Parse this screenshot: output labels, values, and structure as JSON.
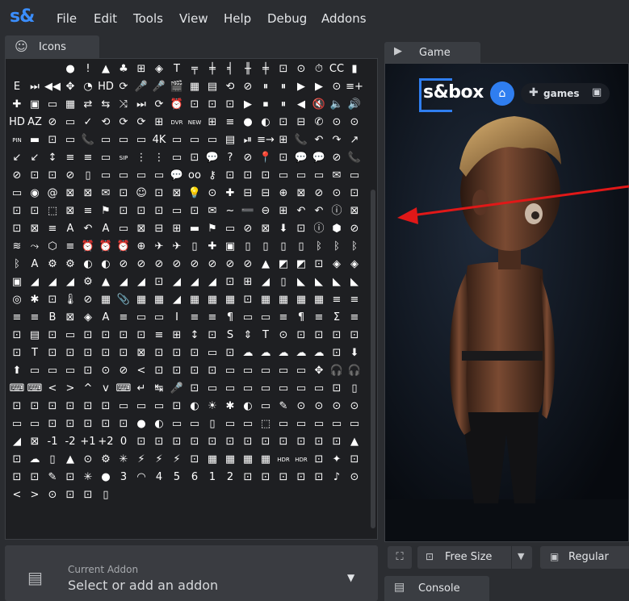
{
  "app": {
    "logo": "s&"
  },
  "menu": [
    "File",
    "Edit",
    "Tools",
    "View",
    "Help",
    "Debug",
    "Addons"
  ],
  "icons_panel": {
    "tab_label": "Icons",
    "tab_icon": "smiley-icon",
    "glyphs": [
      "",
      "",
      "",
      "●",
      "!",
      "▲",
      "♣",
      "⊞",
      "◈",
      "T",
      "╤",
      "╪",
      "╡",
      "╫",
      "╪",
      "⊡",
      "⊙",
      "⏱",
      "CC",
      "▮",
      "E",
      "⏭",
      "◀◀",
      "✥",
      "◔",
      "HD",
      "⟳",
      "🎤",
      "🎤",
      "🎬",
      "▦",
      "▤",
      "⟲",
      "⊘",
      "⏸",
      "⏸",
      "▶",
      "▶",
      "⊙",
      "≡+",
      "✚",
      "▣",
      "▭",
      "▦",
      "⇄",
      "⇆",
      "⤨",
      "⏭",
      "⟳",
      "⏰",
      "⊡",
      "⊡",
      "⊡",
      "▶",
      "⏹",
      "⏸",
      "◀",
      "🔇",
      "🔈",
      "🔊",
      "HD",
      "AZ",
      "⊘",
      "▭",
      "✓",
      "⟲",
      "⟳",
      "⟳",
      "⊞",
      "DVR",
      "NEW",
      "⊞",
      "≡",
      "●",
      "◐",
      "⊡",
      "⊟",
      "✆",
      "⊙",
      "⊙",
      "PIN",
      "▬",
      "⊡",
      "▭",
      "📞",
      "▭",
      "▭",
      "▭",
      "4K",
      "▭",
      "▭",
      "▭",
      "▤",
      "⏯",
      "≡→",
      "⊞",
      "📞",
      "↶",
      "↷",
      "↗",
      "↙",
      "↙",
      "↕",
      "≡",
      "≡",
      "▭",
      "SIP",
      "⋮",
      "⋮",
      "▭",
      "⊡",
      "💬",
      "?",
      "⊘",
      "📍",
      "⊡",
      "💬",
      "💬",
      "⊘",
      "📞",
      "⊘",
      "⊡",
      "⊡",
      "⊘",
      "▯",
      "▭",
      "▭",
      "▭",
      "▭",
      "💬",
      "oo",
      "⚷",
      "⊡",
      "⊡",
      "⊡",
      "▭",
      "▭",
      "▭",
      "✉",
      "▭",
      "▭",
      "◉",
      "@",
      "⊠",
      "⊠",
      "✉",
      "⊡",
      "☺",
      "⊡",
      "⊠",
      "💡",
      "⊙",
      "✚",
      "⊟",
      "⊟",
      "⊕",
      "⊠",
      "⊘",
      "⊙",
      "⊡",
      "⊡",
      "⊡",
      "⬚",
      "⊠",
      "≡",
      "⚑",
      "⊡",
      "⊡",
      "⊡",
      "▭",
      "⊡",
      "✉",
      "∼",
      "➖",
      "⊖",
      "⊞",
      "↶",
      "↶",
      "ⓘ",
      "⊠",
      "⊡",
      "⊠",
      "≡",
      "A",
      "↶",
      "A",
      "▭",
      "⊠",
      "⊟",
      "⊞",
      "▬",
      "⚑",
      "▭",
      "⊘",
      "⊠",
      "⬇",
      "⊡",
      "ⓘ",
      "⬢",
      "⊘",
      "≋",
      "⤳",
      "⬡",
      "≡",
      "⏰",
      "⏰",
      "⏰",
      "⊕",
      "✈",
      "✈",
      "▯",
      "✚",
      "▣",
      "▯",
      "▯",
      "▯",
      "▯",
      "ᛒ",
      "ᛒ",
      "ᛒ",
      "ᛒ",
      "A",
      "⚙",
      "⚙",
      "◐",
      "◐",
      "⊘",
      "⊘",
      "⊘",
      "⊘",
      "⊘",
      "⊘",
      "⊘",
      "⊘",
      "▲",
      "◩",
      "◩",
      "⊡",
      "◈",
      "◈",
      "▣",
      "◢",
      "◢",
      "◢",
      "⚙",
      "▲",
      "◢",
      "◢",
      "⊡",
      "◢",
      "◢",
      "◢",
      "⊡",
      "⊞",
      "◢",
      "▯",
      "◣",
      "◣",
      "◣",
      "◣",
      "◎",
      "✱",
      "⊡",
      "🌡",
      "⊘",
      "▦",
      "📎",
      "▦",
      "▦",
      "◢",
      "▦",
      "▦",
      "▦",
      "⊡",
      "▦",
      "▦",
      "▦",
      "▦",
      "≡",
      "≡",
      "≡",
      "≡",
      "B",
      "⊠",
      "◈",
      "A",
      "≡",
      "▭",
      "▭",
      "I",
      "≡",
      "≡",
      "¶",
      "▭",
      "▭",
      "≡",
      "¶",
      "≡",
      "Σ",
      "≡",
      "⊡",
      "▤",
      "⊡",
      "▭",
      "⊡",
      "⊡",
      "⊡",
      "⊡",
      "≡",
      "⊞",
      "↕",
      "⊡",
      "S",
      "⇕",
      "T",
      "⊙",
      "⊡",
      "⊡",
      "⊡",
      "⊡",
      "⊡",
      "T",
      "⊡",
      "⊡",
      "⊡",
      "⊡",
      "⊡",
      "⊠",
      "⊡",
      "⊡",
      "⊡",
      "▭",
      "⊡",
      "☁",
      "☁",
      "☁",
      "☁",
      "☁",
      "⊡",
      "⬇",
      "⬆",
      "▭",
      "▭",
      "▭",
      "⊡",
      "⊙",
      "⊘",
      "<",
      "⊡",
      "⊡",
      "⊡",
      "⊡",
      "▭",
      "▭",
      "▭",
      "▭",
      "▭",
      "✥",
      "🎧",
      "🎧",
      "⌨",
      "⌨",
      "<",
      ">",
      "^",
      "v",
      "⌨",
      "↵",
      "↹",
      "🎤",
      "⊡",
      "▭",
      "▭",
      "▭",
      "▭",
      "▭",
      "▭",
      "▭",
      "⊡",
      "▯",
      "⊡",
      "⊡",
      "⊡",
      "⊡",
      "⊡",
      "⊡",
      "▭",
      "▭",
      "▭",
      "⊡",
      "◐",
      "☀",
      "✱",
      "◐",
      "▭",
      "✎",
      "⊙",
      "⊙",
      "⊙",
      "⊙",
      "▭",
      "▭",
      "⊡",
      "⊡",
      "⊡",
      "⊡",
      "⊡",
      "●",
      "◐",
      "▭",
      "▭",
      "▯",
      "▭",
      "▭",
      "⬚",
      "▭",
      "▭",
      "▭",
      "▭",
      "▭",
      "◢",
      "⊠",
      "-1",
      "-2",
      "+1",
      "+2",
      "0",
      "⊡",
      "⊡",
      "⊡",
      "⊡",
      "⊡",
      "⊡",
      "⊡",
      "⊡",
      "⊡",
      "⊡",
      "⊡",
      "⊡",
      "▲",
      "⊡",
      "☁",
      "▯",
      "▲",
      "⊙",
      "⚙",
      "✳",
      "⚡",
      "⚡",
      "⚡",
      "⊡",
      "▦",
      "▦",
      "▦",
      "▦",
      "HDR",
      "HDR",
      "⊡",
      "✦",
      "⊡",
      "⊡",
      "⊡",
      "✎",
      "⊡",
      "✳",
      "●",
      "3",
      "◠",
      "4",
      "5",
      "6",
      "1",
      "2",
      "⊡",
      "⊡",
      "⊡",
      "⊡",
      "⊡",
      "♪",
      "⊙",
      "<",
      ">",
      "⊙",
      "⊡",
      "⊡",
      "▯"
    ]
  },
  "addon_selector": {
    "caption": "Current Addon",
    "value": "Select or add an addon",
    "icon": "addon-document-icon"
  },
  "game_panel": {
    "tab_label": "Game",
    "tab_icon": "play-icon",
    "overlay": {
      "logo_text": "s&box",
      "home_icon": "home-icon",
      "games_label": "games",
      "games_icon": "gamepad-icon",
      "save_icon": "save-icon"
    }
  },
  "game_toolbar": {
    "fullscreen_icon": "fullscreen-icon",
    "size_label": "Free Size",
    "size_icon": "aspect-icon",
    "mode_label": "Regular",
    "mode_icon": "image-icon"
  },
  "console_panel": {
    "tab_label": "Console",
    "tab_icon": "document-icon"
  },
  "colors": {
    "accent": "#2f7ef0",
    "annotation_arrow": "#e01818",
    "background": "#2b2d31",
    "panel": "#1e1f22"
  }
}
